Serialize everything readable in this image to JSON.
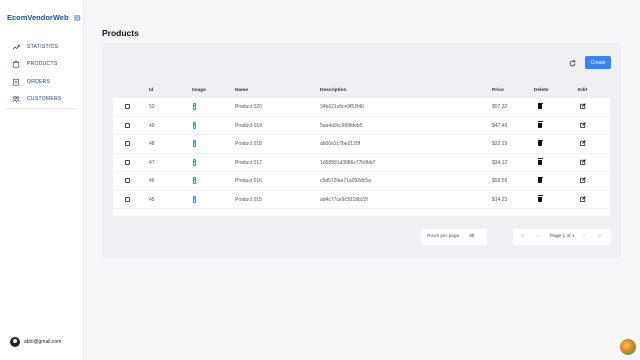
{
  "app": {
    "title": "EcomVendorWeb"
  },
  "sidebar": {
    "items": [
      {
        "label": "STATISTICS",
        "icon": "trend-icon"
      },
      {
        "label": "PRODUCTS",
        "icon": "bag-icon"
      },
      {
        "label": "ORDERS",
        "icon": "clipboard-icon"
      },
      {
        "label": "CUSTOMERS",
        "icon": "users-icon"
      }
    ]
  },
  "user": {
    "email": "abhi@gmail.com"
  },
  "page": {
    "title": "Products"
  },
  "toolbar": {
    "create_label": "Create"
  },
  "table": {
    "columns": {
      "id": "Id",
      "image": "Image",
      "name": "Name",
      "description": "Description",
      "price": "Price",
      "delete": "Delete",
      "edit": "Edit"
    },
    "rows": [
      {
        "id": "50",
        "name": "Product 020",
        "description": "34b621c8ce9f52f40",
        "price": "$57.32"
      },
      {
        "id": "49",
        "name": "Product 019",
        "description": "5aa4a9cc9d9fdeb5",
        "price": "$47.49"
      },
      {
        "id": "48",
        "name": "Product 018",
        "description": "ab00e2c7be2120f",
        "price": "$22.19"
      },
      {
        "id": "47",
        "name": "Product 017",
        "description": "1d58991d3086c77b0bb7",
        "price": "$34.12"
      },
      {
        "id": "46",
        "name": "Product 016",
        "description": "c5d572fae71a092dc5a",
        "price": "$59.59"
      },
      {
        "id": "45",
        "name": "Product 015",
        "description": "ad4c77ce9c9218b22f",
        "price": "$14.23"
      }
    ]
  },
  "pagination": {
    "rows_per_page_label": "Rows per page",
    "rows_per_page_value": "30",
    "page_label": "Page 1 of 1"
  },
  "colors": {
    "accent": "#3b82f6",
    "brand": "#1f4ea8"
  }
}
